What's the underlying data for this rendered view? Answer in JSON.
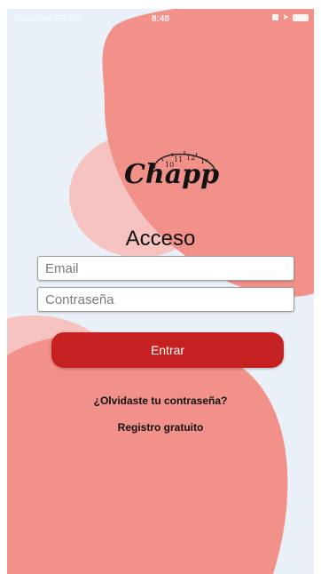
{
  "status_bar": {
    "carrier": "vodafone ES 4G",
    "time": "8:48",
    "icons": [
      "lock-icon",
      "location-icon",
      "battery-icon"
    ]
  },
  "colors": {
    "background": "#eaf0f7",
    "blob_main": "#f2908a",
    "blob_light": "#f7c3c0",
    "button": "#c62121"
  },
  "logo": {
    "text": "Chapp",
    "clock_numbers": [
      "10",
      "11",
      "12",
      "1"
    ]
  },
  "login": {
    "title": "Acceso",
    "email_placeholder": "Email",
    "password_placeholder": "Contraseña",
    "submit_label": "Entrar",
    "forgot_password_link": "¿Olvidaste tu contraseña?",
    "register_link": "Registro gratuito"
  }
}
